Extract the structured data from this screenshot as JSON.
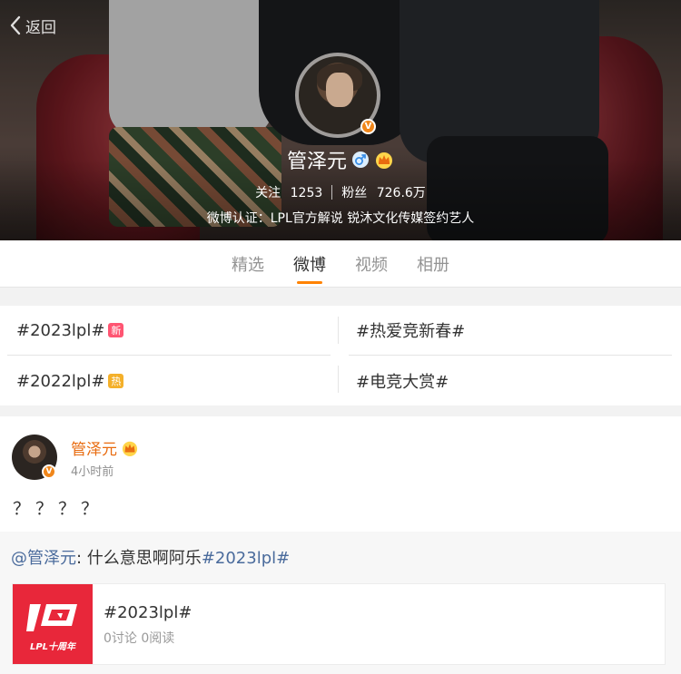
{
  "header": {
    "back_label": "返回",
    "name": "管泽元",
    "follow_label": "关注",
    "follow_count": "1253",
    "fans_label": "粉丝",
    "fans_count": "726.6万",
    "verify_text": "微博认证：LPL官方解说 锐沐文化传媒签约艺人",
    "badge_letter": "V"
  },
  "tabs": [
    {
      "label": "精选",
      "active": false
    },
    {
      "label": "微博",
      "active": true
    },
    {
      "label": "视频",
      "active": false
    },
    {
      "label": "相册",
      "active": false
    }
  ],
  "topics": [
    {
      "label": "#2023lpl#",
      "tag": "新"
    },
    {
      "label": "#热爱竞新春#",
      "tag": ""
    },
    {
      "label": "#2022lpl#",
      "tag": "热"
    },
    {
      "label": "#电竞大赏#",
      "tag": ""
    }
  ],
  "post": {
    "author": "管泽元",
    "time": "4小时前",
    "text": "？？？？",
    "repost": {
      "mention": "@管泽元",
      "colon": ":",
      "text": " 什么意思啊阿乐",
      "hashtag": "#2023lpl#"
    },
    "card": {
      "title": "#2023lpl#",
      "meta": "0讨论 0阅读",
      "thumb_text": "LPL十周年"
    }
  },
  "colors": {
    "accent": "#ff8200",
    "author": "#e86b0f",
    "link": "#4a6b9c",
    "tag_new": "#ff5572",
    "tag_hot": "#f4b02a",
    "thumb_bg": "#e8273a"
  }
}
